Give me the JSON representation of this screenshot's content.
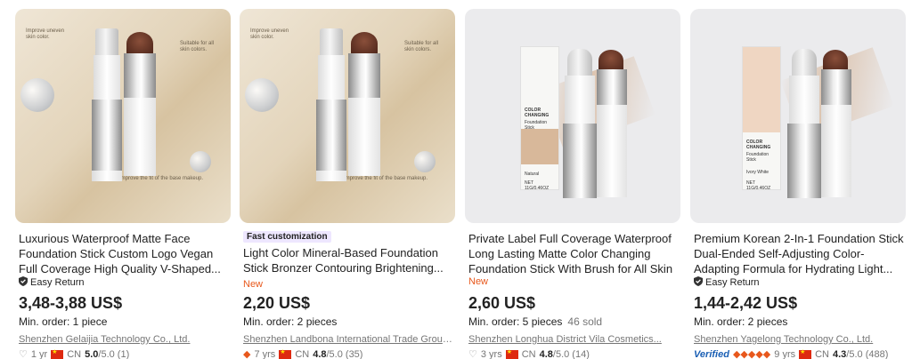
{
  "products": [
    {
      "thumb_notes": [
        "Improve uneven skin color.",
        "Suitable for all skin colors.",
        "Improve the fit of the base makeup."
      ],
      "badge": "",
      "title": "Luxurious Waterproof Matte Face Foundation Stick Custom Logo Vegan Full Coverage High Quality V-Shaped...",
      "tag": "Easy Return",
      "price": "3,48-3,88 US$",
      "min_order": "Min. order: 1 piece",
      "sold": "",
      "supplier": "Shenzhen Gelaijia Technology Co., Ltd.",
      "years": "1 yr",
      "country": "CN",
      "rating": "5.0",
      "rating_suffix": "/5.0 (1)"
    },
    {
      "thumb_notes": [
        "Improve uneven skin color.",
        "Suitable for all skin colors.",
        "Improve the fit of the base makeup."
      ],
      "badge": "Fast customization",
      "title": "Light Color Mineral-Based Foundation Stick Bronzer Contouring Brightening...",
      "tag": "New",
      "price": "2,20 US$",
      "min_order": "Min. order: 2 pieces",
      "sold": "",
      "supplier": "Shenzhen Landbona International Trade Group...",
      "years": "7 yrs",
      "country": "CN",
      "rating": "4.8",
      "rating_suffix": "/5.0 (35)"
    },
    {
      "box_label": "COLOR CHANGING",
      "box_sub": "Foundation Stick",
      "box_shade": "Natural",
      "box_net": "NET 11G/0.46OZ",
      "badge": "",
      "title": "Private Label Full Coverage Waterproof Long Lasting Matte Color Changing Foundation Stick With Brush for All Skin",
      "tag": "New",
      "price": "2,60 US$",
      "min_order": "Min. order: 5 pieces",
      "sold": "46 sold",
      "supplier": "Shenzhen Longhua District Vila Cosmetics...",
      "years": "3 yrs",
      "country": "CN",
      "rating": "4.8",
      "rating_suffix": "/5.0 (14)"
    },
    {
      "box_label": "COLOR CHANGING",
      "box_sub": "Foundation Stick",
      "box_shade": "Ivory White",
      "box_net": "NET 11G/0.46OZ",
      "badge": "",
      "title": "Premium Korean 2-In-1 Foundation Stick Dual-Ended Self-Adjusting Color-Adapting Formula for Hydrating Light...",
      "tag": "Easy Return",
      "price": "1,44-2,42 US$",
      "min_order": "Min. order: 2 pieces",
      "sold": "",
      "supplier": "Shenzhen Yagelong Technology Co., Ltd.",
      "verified": "Verified",
      "years": "9 yrs",
      "country": "CN",
      "rating": "4.3",
      "rating_suffix": "/5.0 (488)"
    }
  ],
  "colors": {
    "new_tag": "#e8581c",
    "badge_bg": "#eee7ff",
    "verified": "#1a5fb4"
  },
  "icons": {
    "easy_return": "shield-check-icon",
    "years": "diamond-icon",
    "flag": "china-flag-icon"
  }
}
